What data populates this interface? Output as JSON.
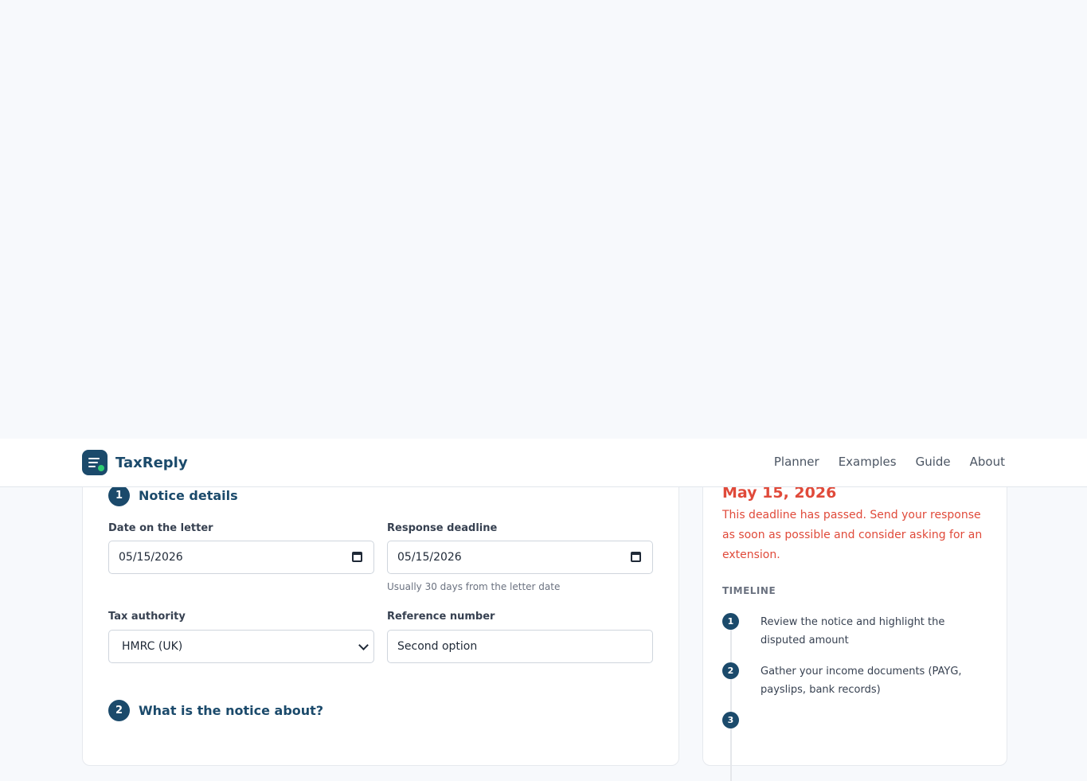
{
  "brand": {
    "name": "TaxReply"
  },
  "nav": {
    "links": [
      "Planner",
      "Examples",
      "Guide",
      "About"
    ]
  },
  "section1": {
    "number": "1",
    "title": "Notice details",
    "letter_date_label": "Date on the letter",
    "letter_date_value": "05/15/2026",
    "deadline_label": "Response deadline",
    "deadline_value": "05/15/2026",
    "deadline_hint": "Usually 30 days from the letter date",
    "authority_label": "Tax authority",
    "authority_value": "HMRC (UK)",
    "reference_label": "Reference number",
    "reference_value": "Second option"
  },
  "section2": {
    "number": "2",
    "title": "What is the notice about?"
  },
  "sidebar": {
    "deadline_date": "May 15, 2026",
    "deadline_message": "This deadline has passed. Send your response as soon as possible and consider asking for an extension.",
    "timeline_label": "TIMELINE",
    "timeline": [
      {
        "number": "1",
        "text": "Review the notice and highlight the disputed amount"
      },
      {
        "number": "2",
        "text": "Gather your income documents (PAYG, payslips, bank records)"
      },
      {
        "number": "3",
        "text": ""
      }
    ]
  },
  "colors": {
    "primary": "#1b4a6b",
    "alert": "#e04a3a",
    "background": "#f7f9fc"
  }
}
